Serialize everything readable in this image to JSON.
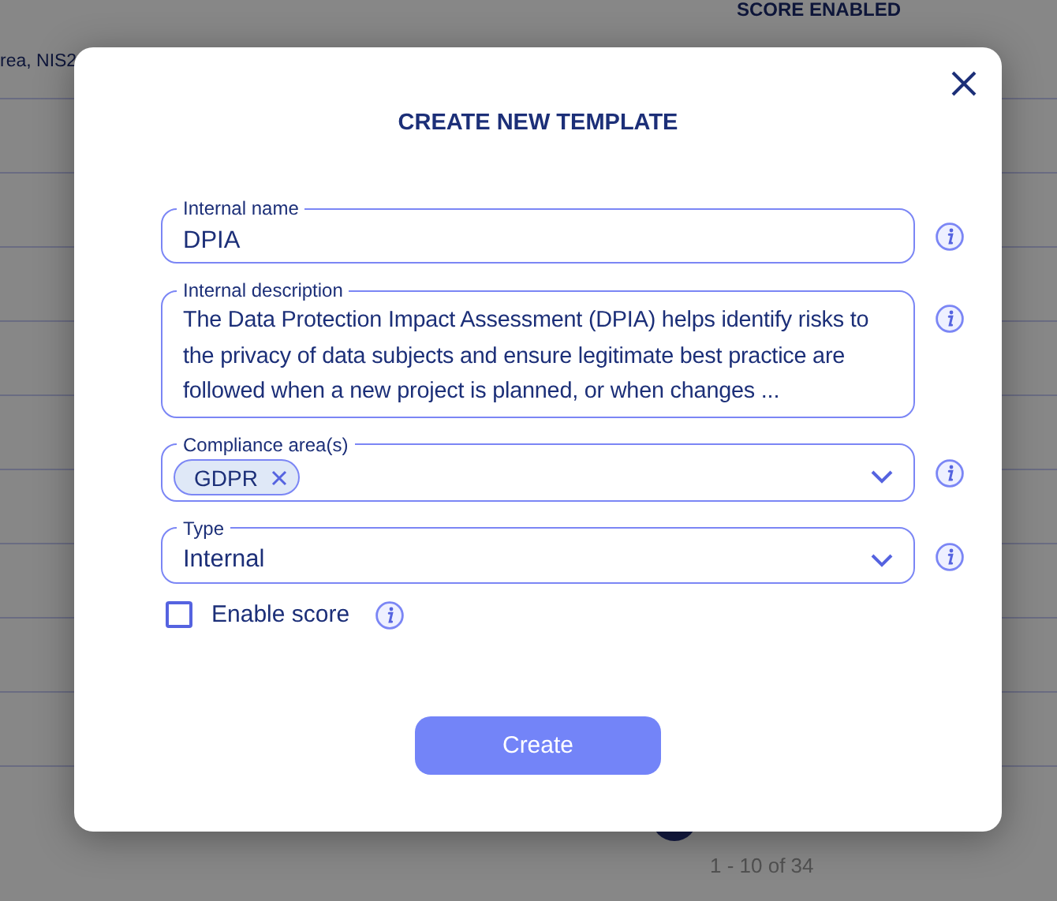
{
  "background": {
    "column_header": "SCORE ENABLED",
    "cell": "rea, NIS2",
    "pagination": "1 - 10 of 34"
  },
  "dialog": {
    "title": "CREATE NEW TEMPLATE",
    "fields": [
      {
        "kind": "text",
        "label": "Internal name",
        "value": "DPIA"
      },
      {
        "kind": "textarea",
        "label": "Internal description",
        "value": "The Data Protection Impact Assessment (DPIA) helps identify risks to the privacy of data subjects and ensure legitimate best practice are followed when a new project is planned, or when changes ..."
      },
      {
        "kind": "chips",
        "label": "Compliance area(s)",
        "chips": [
          "GDPR"
        ]
      },
      {
        "kind": "select",
        "label": "Type",
        "value": "Internal"
      }
    ],
    "checkbox": {
      "label": "Enable score",
      "checked": false
    },
    "button": "Create"
  }
}
